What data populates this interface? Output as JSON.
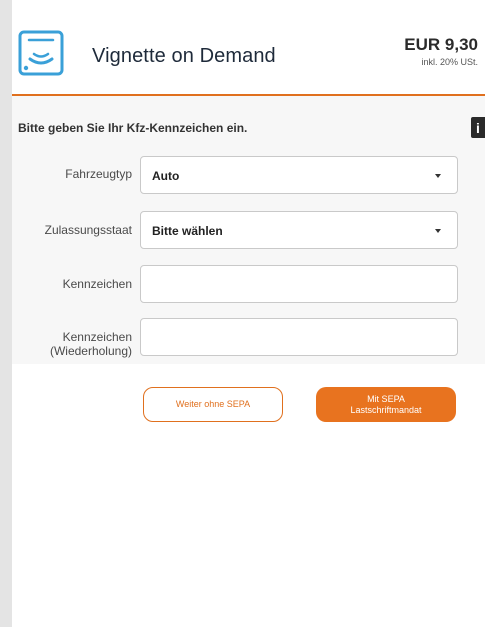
{
  "header": {
    "title": "Vignette on Demand",
    "price": "EUR 9,30",
    "tax_note": "inkl. 20% USt.",
    "logo_icon": "vignette-card-icon",
    "accent_color": "#e0701e"
  },
  "form": {
    "instruction": "Bitte geben Sie Ihr Kfz-Kennzeichen ein.",
    "side_icon": "info-icon",
    "vehicle_type": {
      "label": "Fahrzeugtyp",
      "value": "Auto"
    },
    "country": {
      "label": "Zulassungsstaat",
      "value": "Bitte wählen"
    },
    "plate": {
      "label": "Kennzeichen",
      "value": ""
    },
    "plate_repeat": {
      "label_line1": "Kennzeichen",
      "label_line2": "(Wiederholung)",
      "value": ""
    }
  },
  "buttons": {
    "without_sepa": "Weiter ohne SEPA",
    "with_sepa_line1": "Mit SEPA",
    "with_sepa_line2": "Lastschriftmandat"
  }
}
